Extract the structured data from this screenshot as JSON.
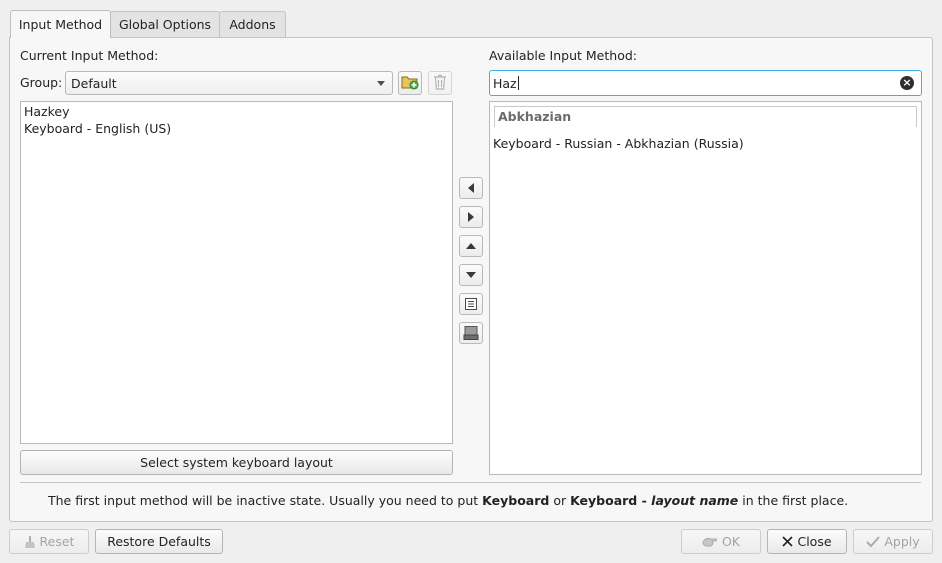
{
  "tabs": [
    {
      "label": "Input Method",
      "active": true
    },
    {
      "label": "Global Options",
      "active": false
    },
    {
      "label": "Addons",
      "active": false
    }
  ],
  "left": {
    "heading": "Current Input Method:",
    "group_label": "Group:",
    "group_value": "Default",
    "items": [
      "Hazkey",
      "Keyboard - English (US)"
    ],
    "select_layout_button": "Select system keyboard layout"
  },
  "right": {
    "heading": "Available Input Method:",
    "search_value": "Haz",
    "section": "Abkhazian",
    "items": [
      "Keyboard - Russian - Abkhazian (Russia)"
    ]
  },
  "icons": {
    "add_group": "folder-add-icon",
    "delete_group": "trash-icon",
    "move_left": "arrow-left-icon",
    "move_right": "arrow-right-icon",
    "move_up": "arrow-up-icon",
    "move_down": "arrow-down-icon",
    "configure": "configure-icon",
    "keyboard_layout": "keyboard-layout-icon",
    "clear_search": "clear-icon"
  },
  "hint": {
    "prefix": "The first input method will be inactive state. Usually you need to put ",
    "bold1": "Keyboard",
    "middle": " or ",
    "bold2": "Keyboard - ",
    "italic": "layout name",
    "suffix": " in the first place."
  },
  "footer": {
    "reset": "Reset",
    "restore_defaults": "Restore Defaults",
    "ok": "OK",
    "close": "Close",
    "apply": "Apply"
  },
  "colors": {
    "focus_accent": "#3daee9",
    "window_bg": "#efefef"
  }
}
